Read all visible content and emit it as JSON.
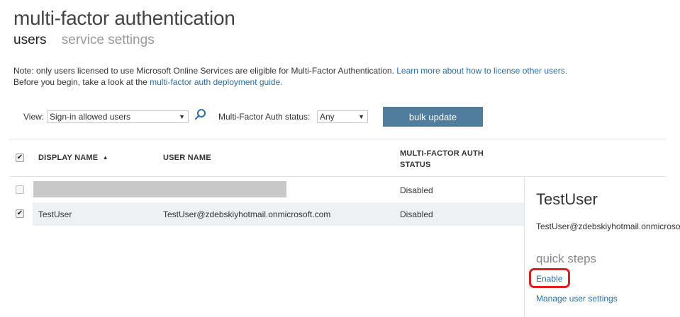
{
  "page": {
    "title": "multi-factor authentication",
    "tabs": [
      {
        "label": "users",
        "active": true
      },
      {
        "label": "service settings",
        "active": false
      }
    ]
  },
  "note": {
    "line1_text": "Note: only users licensed to use Microsoft Online Services are eligible for Multi-Factor Authentication. ",
    "line1_link": "Learn more about how to license other users.",
    "line2_text": "Before you begin, take a look at the ",
    "line2_link": "multi-factor auth deployment guide."
  },
  "filters": {
    "view_label": "View:",
    "view_value": "Sign-in allowed users",
    "status_label": "Multi-Factor Auth status:",
    "status_value": "Any",
    "bulk_update_label": "bulk update"
  },
  "table": {
    "headers": {
      "display_name": "DISPLAY NAME",
      "user_name": "USER NAME",
      "mfa_status_line1": "MULTI-FACTOR AUTH",
      "mfa_status_line2": "STATUS"
    },
    "select_all_checked": true,
    "rows": [
      {
        "display_name": "",
        "user_name": "",
        "status": "Disabled",
        "checked": false,
        "redacted": true
      },
      {
        "display_name": "TestUser",
        "user_name": "TestUser@zdebskiyhotmail.onmicrosoft.com",
        "status": "Disabled",
        "checked": true,
        "redacted": false
      }
    ]
  },
  "details_panel": {
    "user_name": "TestUser",
    "email": "TestUser@zdebskiyhotmail.onmicrosoft.com",
    "quick_steps_title": "quick steps",
    "enable_label": "Enable",
    "manage_label": "Manage user settings"
  },
  "colors": {
    "link": "#2a6ea8",
    "button": "#507d9d",
    "highlight_box": "#e01e1e",
    "selected_row": "#edf1f4"
  }
}
